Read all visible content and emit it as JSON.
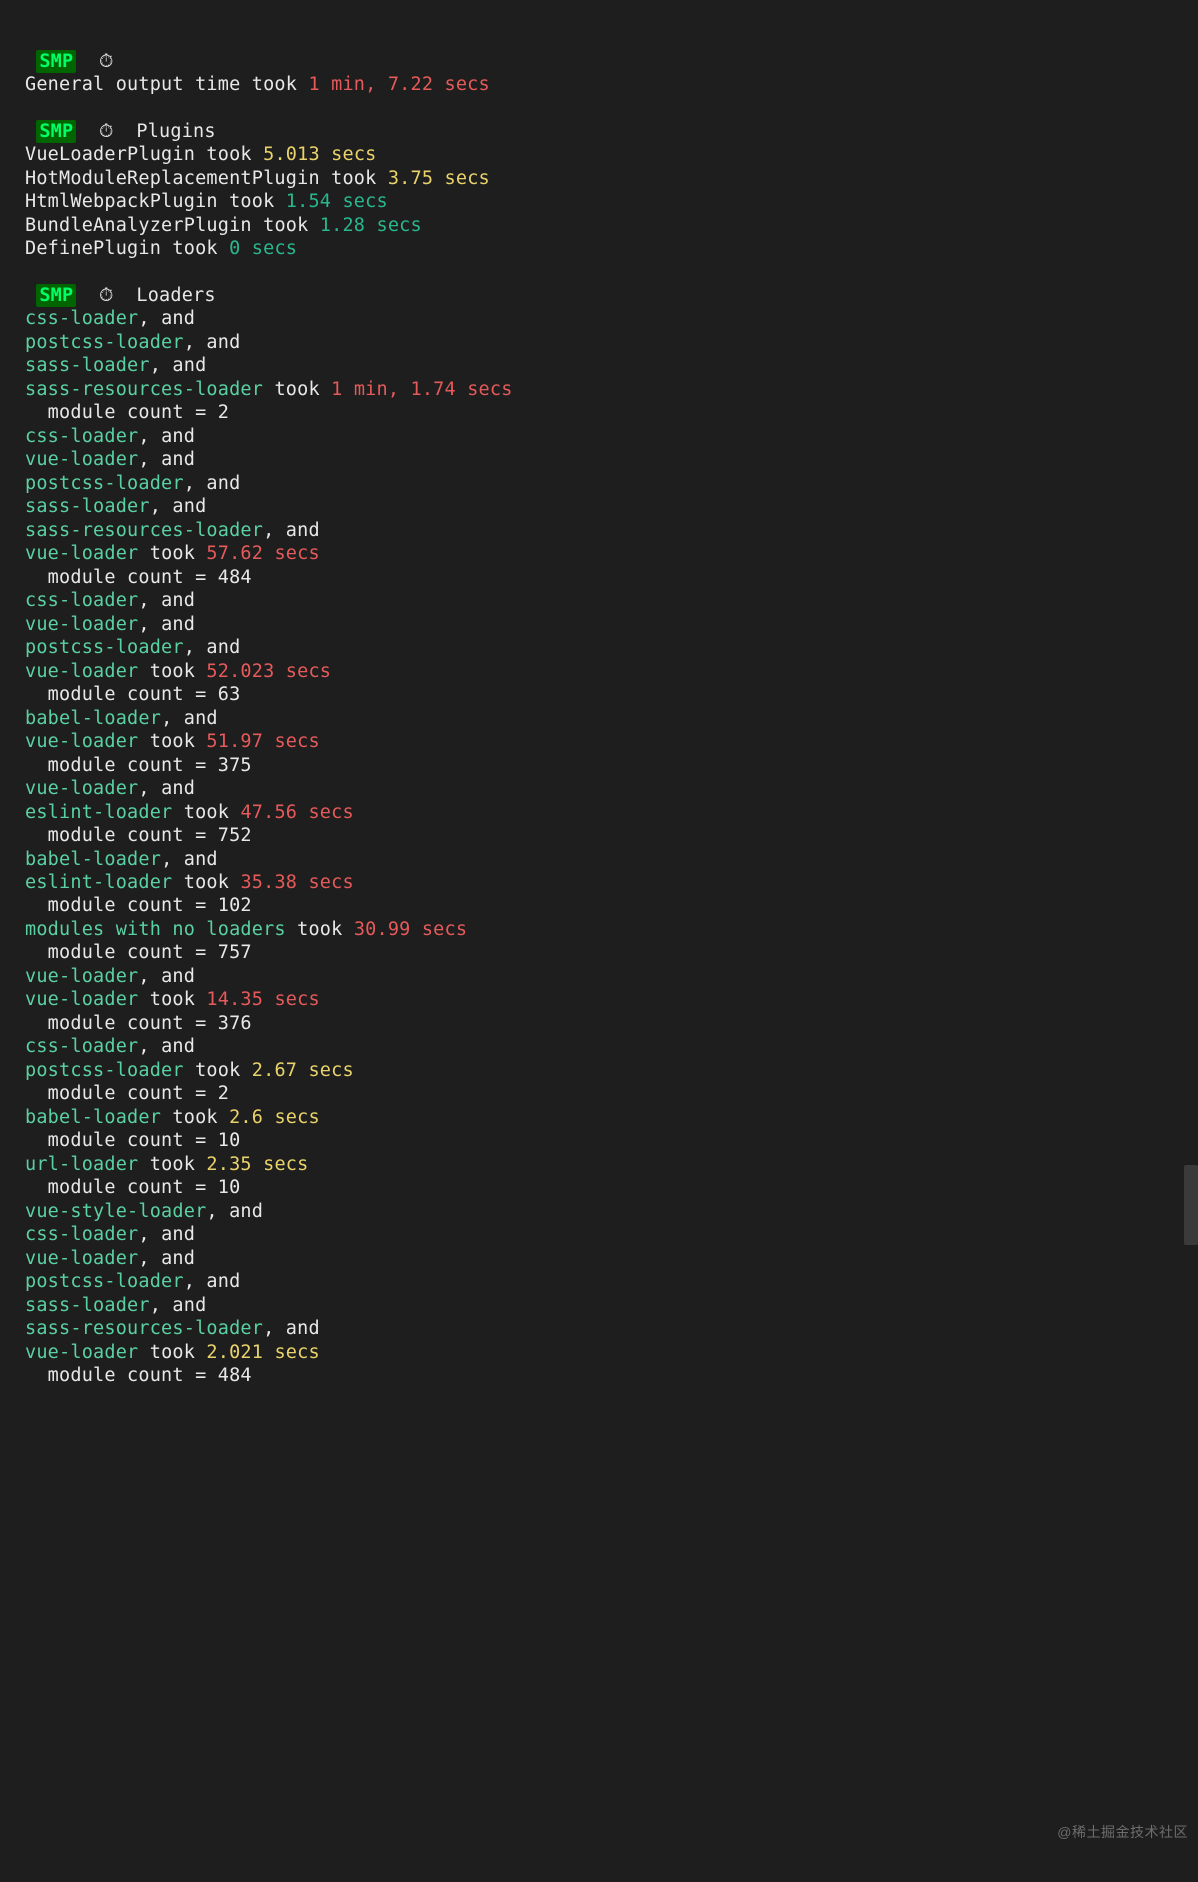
{
  "badge": "SMP",
  "icon": "⏱",
  "general": {
    "prefix": "General output time took ",
    "time": "1 min, 7.22 secs",
    "timeClass": "c-red"
  },
  "plugins": {
    "heading": "Plugins",
    "items": [
      {
        "name": "VueLoaderPlugin",
        "took": " took ",
        "time": "5.013 secs",
        "timeClass": "c-yellow"
      },
      {
        "name": "HotModuleReplacementPlugin",
        "took": " took ",
        "time": "3.75 secs",
        "timeClass": "c-yellow"
      },
      {
        "name": "HtmlWebpackPlugin",
        "took": " took ",
        "time": "1.54 secs",
        "timeClass": "c-teal"
      },
      {
        "name": "BundleAnalyzerPlugin",
        "took": " took ",
        "time": "1.28 secs",
        "timeClass": "c-teal"
      },
      {
        "name": "DefinePlugin",
        "took": " took ",
        "time": "0 secs",
        "timeClass": "c-teal"
      }
    ]
  },
  "loaders": {
    "heading": "Loaders",
    "entries": [
      {
        "chain": [
          "css-loader",
          "postcss-loader",
          "sass-loader",
          "sass-resources-loader"
        ],
        "time": "1 min, 1.74 secs",
        "timeClass": "c-red",
        "moduleCount": "2"
      },
      {
        "chain": [
          "css-loader",
          "vue-loader",
          "postcss-loader",
          "sass-loader",
          "sass-resources-loader",
          "vue-loader"
        ],
        "time": "57.62 secs",
        "timeClass": "c-red",
        "moduleCount": "484"
      },
      {
        "chain": [
          "css-loader",
          "vue-loader",
          "postcss-loader",
          "vue-loader"
        ],
        "time": "52.023 secs",
        "timeClass": "c-red",
        "moduleCount": "63"
      },
      {
        "chain": [
          "babel-loader",
          "vue-loader"
        ],
        "time": "51.97 secs",
        "timeClass": "c-red",
        "moduleCount": "375"
      },
      {
        "chain": [
          "vue-loader",
          "eslint-loader"
        ],
        "time": "47.56 secs",
        "timeClass": "c-red",
        "moduleCount": "752"
      },
      {
        "chain": [
          "babel-loader",
          "eslint-loader"
        ],
        "time": "35.38 secs",
        "timeClass": "c-red",
        "moduleCount": "102"
      },
      {
        "chain": [
          "modules with no loaders"
        ],
        "time": "30.99 secs",
        "timeClass": "c-red",
        "moduleCount": "757"
      },
      {
        "chain": [
          "vue-loader",
          "vue-loader"
        ],
        "time": "14.35 secs",
        "timeClass": "c-red",
        "moduleCount": "376"
      },
      {
        "chain": [
          "css-loader",
          "postcss-loader"
        ],
        "time": "2.67 secs",
        "timeClass": "c-yellow",
        "moduleCount": "2"
      },
      {
        "chain": [
          "babel-loader"
        ],
        "time": "2.6 secs",
        "timeClass": "c-yellow",
        "moduleCount": "10"
      },
      {
        "chain": [
          "url-loader"
        ],
        "time": "2.35 secs",
        "timeClass": "c-yellow",
        "moduleCount": "10"
      },
      {
        "chain": [
          "vue-style-loader",
          "css-loader",
          "vue-loader",
          "postcss-loader",
          "sass-loader",
          "sass-resources-loader",
          "vue-loader"
        ],
        "time": "2.021 secs",
        "timeClass": "c-yellow",
        "moduleCount": "484"
      }
    ],
    "andSuffix": ", and",
    "tookWord": " took ",
    "moduleLabel": "  module count = "
  },
  "watermark": "@稀土掘金技术社区"
}
